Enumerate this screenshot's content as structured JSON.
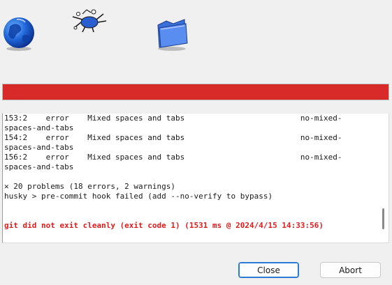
{
  "toolbar": {
    "icons": [
      {
        "name": "globe-icon"
      },
      {
        "name": "bug-icon"
      },
      {
        "name": "folder-icon"
      }
    ]
  },
  "progress": {
    "value_percent": 100,
    "color": "#d92a2a"
  },
  "log": {
    "lines": [
      "153:2    error    Mixed spaces and tabs                         no-mixed-",
      "spaces-and-tabs",
      "154:2    error    Mixed spaces and tabs                         no-mixed-",
      "spaces-and-tabs",
      "156:2    error    Mixed spaces and tabs                         no-mixed-",
      "spaces-and-tabs",
      "",
      "✕ 20 problems (18 errors, 2 warnings)",
      "husky > pre-commit hook failed (add --no-verify to bypass)",
      "",
      "",
      "git did not exit cleanly (exit code 1) (1531 ms @ 2024/4/15 14:33:56)"
    ],
    "error_color": "#e01b1b"
  },
  "buttons": {
    "close_label": "Close",
    "abort_label": "Abort"
  }
}
